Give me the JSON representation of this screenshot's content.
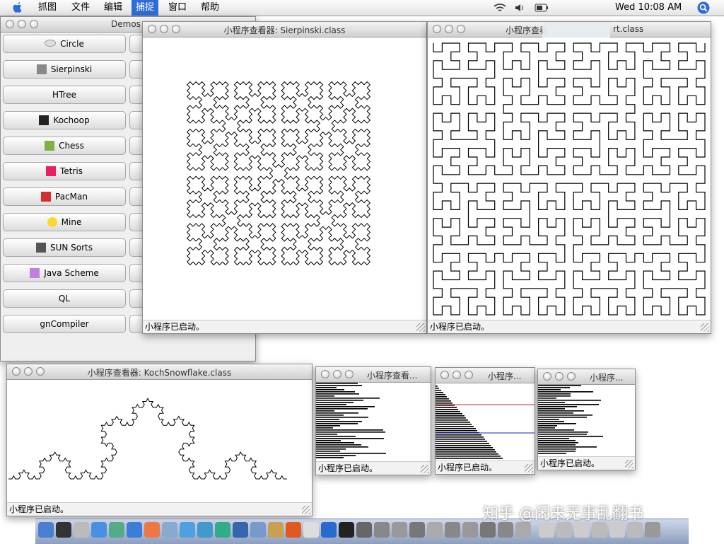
{
  "menubar": {
    "menus": [
      "抓图",
      "文件",
      "编辑",
      "捕捉",
      "窗口",
      "帮助"
    ],
    "active_menu": "捕捉",
    "clock": "Wed 10:08 AM"
  },
  "demos": {
    "title": "Demos",
    "buttons": [
      "Circle",
      "Sierpinski",
      "HTree",
      "Kochoop",
      "Chess",
      "Tetris",
      "PacMan",
      "Mine",
      "SUN Sorts",
      "Java Scheme",
      "QL",
      "gnCompiler"
    ]
  },
  "windows": {
    "sierpinski": {
      "title": "小程序查看器: Sierpinski.class",
      "status": "小程序已启动。"
    },
    "hilbert": {
      "title": "小程序查看",
      "title_suffix": "rt.class",
      "status": "小程序已启动。"
    },
    "koch": {
      "title": "小程序查看器: KochSnowflake.class",
      "status": "小程序已启动。"
    },
    "sort1": {
      "title": "小程序查看...",
      "status": "小程序已启动。"
    },
    "sort2": {
      "title": "小程序...",
      "status": "小程序已启动。"
    },
    "sort3": {
      "title": "小程序...",
      "status": "小程序已启动。"
    }
  },
  "watermark": "知乎 @闲来无事乱翻书",
  "colors": {
    "menu_highlight": "#2f6cd6",
    "sort_red": "#d42020",
    "sort_blue": "#2020c8"
  }
}
